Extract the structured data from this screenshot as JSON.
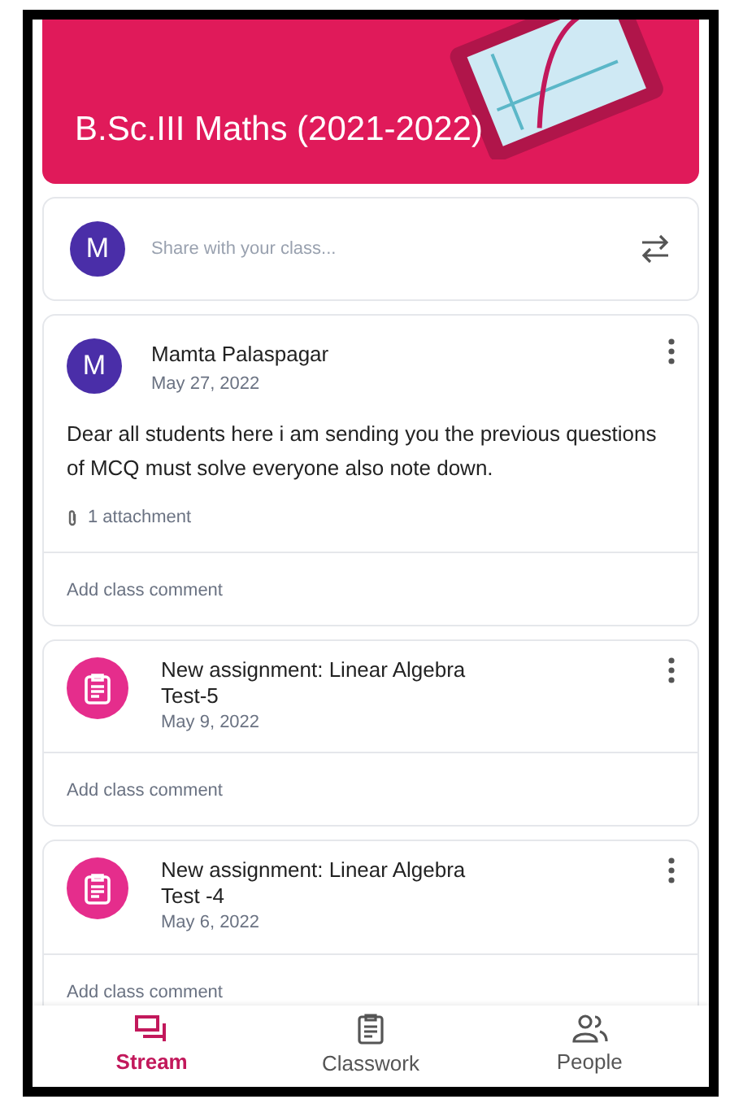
{
  "banner": {
    "title": "B.Sc.III Maths (2021-2022)"
  },
  "share": {
    "avatar": "M",
    "placeholder": "Share with your class..."
  },
  "posts": [
    {
      "kind": "announcement",
      "avatar": "M",
      "author": "Mamta Palaspagar",
      "date": "May 27, 2022",
      "body": "Dear all students here i am sending you the previous questions of MCQ must solve everyone also note down.",
      "attachments": "1 attachment",
      "comment": "Add class comment"
    },
    {
      "kind": "assignment",
      "title": "New assignment: Linear Algebra Test-5",
      "date": "May 9, 2022",
      "comment": "Add class comment"
    },
    {
      "kind": "assignment",
      "title": "New assignment: Linear Algebra Test -4",
      "date": "May 6, 2022",
      "comment": "Add class comment"
    }
  ],
  "nav": [
    {
      "kind": "stream",
      "label": "Stream",
      "selected": true
    },
    {
      "kind": "classwork",
      "label": "Classwork",
      "selected": false
    },
    {
      "kind": "people",
      "label": "People",
      "selected": false
    }
  ]
}
